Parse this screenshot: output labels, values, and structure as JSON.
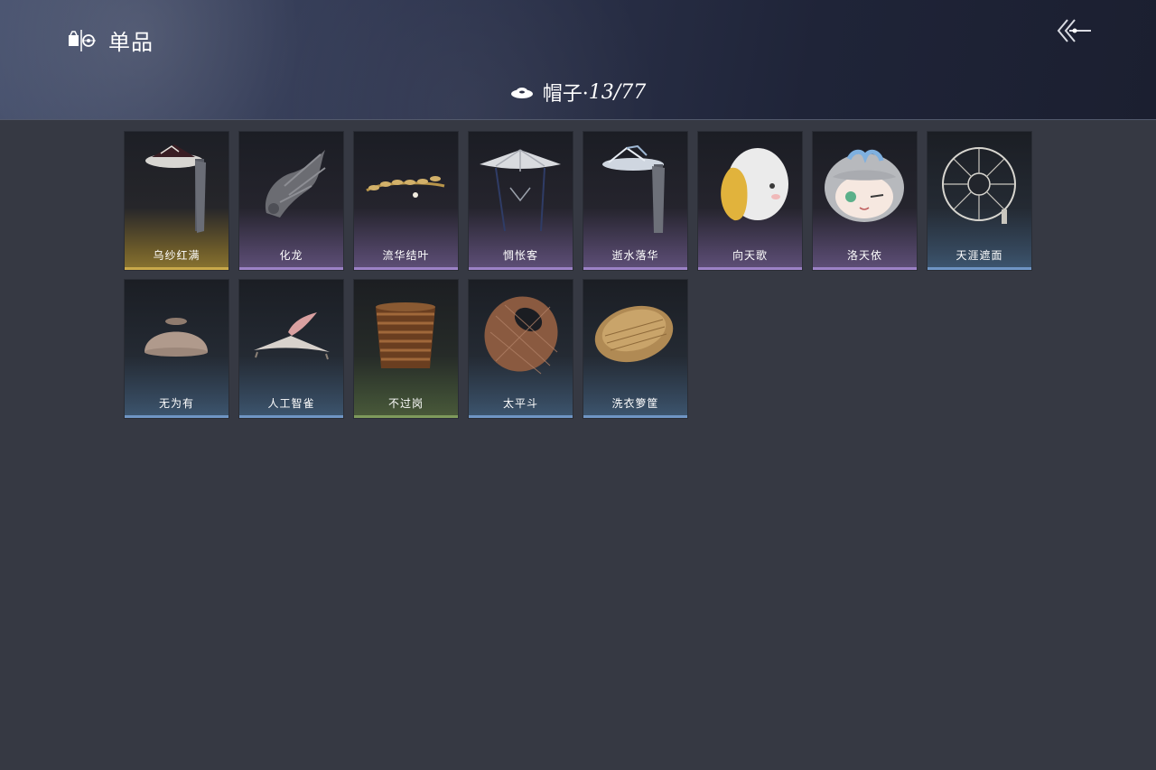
{
  "header": {
    "title": "单品",
    "category_label": "帽子·",
    "category_count": "13/77"
  },
  "items": [
    {
      "name": "乌纱红满",
      "rarity": "gold",
      "icon": "black-gauze-hat-with-veil-icon"
    },
    {
      "name": "化龙",
      "rarity": "purple",
      "icon": "dragon-headpiece-icon"
    },
    {
      "name": "流华结叶",
      "rarity": "purple",
      "icon": "golden-leaf-circlet-icon"
    },
    {
      "name": "惆怅客",
      "rarity": "purple",
      "icon": "conical-hat-icon"
    },
    {
      "name": "逝水落华",
      "rarity": "purple",
      "icon": "veiled-bamboo-hat-icon"
    },
    {
      "name": "向天歌",
      "rarity": "purple",
      "icon": "goose-plush-hat-icon"
    },
    {
      "name": "洛天依",
      "rarity": "purple",
      "icon": "luo-tianyi-plush-head-icon"
    },
    {
      "name": "天涯遮面",
      "rarity": "blue",
      "icon": "spoked-veil-hat-icon"
    },
    {
      "name": "无为有",
      "rarity": "blue",
      "icon": "clay-bowl-hat-icon"
    },
    {
      "name": "人工智雀",
      "rarity": "blue",
      "icon": "sparrow-hat-icon"
    },
    {
      "name": "不过岗",
      "rarity": "green",
      "icon": "stacked-bowls-hat-icon"
    },
    {
      "name": "太平斗",
      "rarity": "blue",
      "icon": "woven-basket-hat-icon"
    },
    {
      "name": "洗衣箩筐",
      "rarity": "blue",
      "icon": "laundry-basket-hat-icon"
    }
  ],
  "colors": {
    "background": "#363943",
    "gold": "#c9a94a",
    "purple": "#9c82c6",
    "blue": "#6f95c4",
    "green": "#7e9a5c"
  }
}
